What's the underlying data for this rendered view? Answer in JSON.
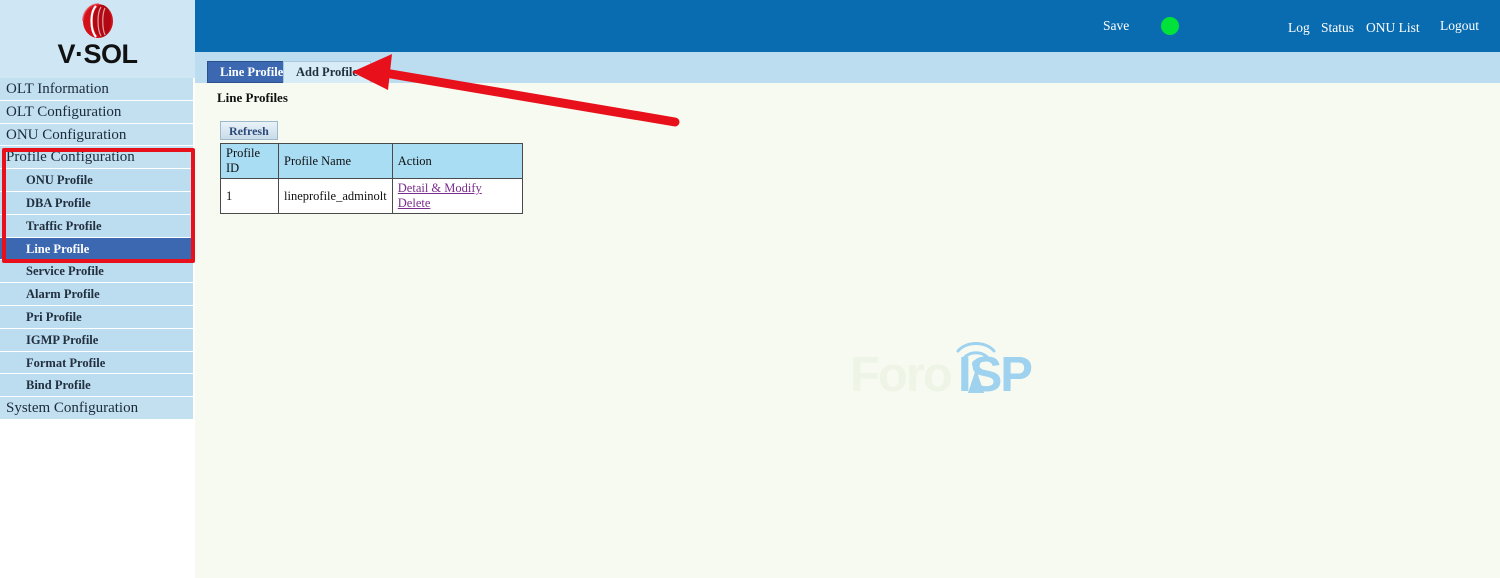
{
  "brand": {
    "logo_text": "V·SOL",
    "logo_icon": "vsol-sphere-logo"
  },
  "header": {
    "save_label": "Save",
    "status_dot": "status-indicator-green",
    "status_dot_color": "#00e23a",
    "log_label": "Log",
    "status_label": "Status",
    "onu_list_label": "ONU List",
    "logout_label": "Logout",
    "background_color": "#0a6cb0"
  },
  "sidebar": {
    "items": [
      {
        "label": "OLT Information",
        "level": "top",
        "selected": false
      },
      {
        "label": "OLT Configuration",
        "level": "top",
        "selected": false
      },
      {
        "label": "ONU Configuration",
        "level": "top",
        "selected": false
      },
      {
        "label": "Profile Configuration",
        "level": "top",
        "selected": false
      },
      {
        "label": "ONU Profile",
        "level": "sub",
        "selected": false
      },
      {
        "label": "DBA Profile",
        "level": "sub",
        "selected": false
      },
      {
        "label": "Traffic Profile",
        "level": "sub",
        "selected": false
      },
      {
        "label": "Line Profile",
        "level": "sub",
        "selected": true
      },
      {
        "label": "Service Profile",
        "level": "sub",
        "selected": false
      },
      {
        "label": "Alarm Profile",
        "level": "sub",
        "selected": false
      },
      {
        "label": "Pri Profile",
        "level": "sub",
        "selected": false
      },
      {
        "label": "IGMP Profile",
        "level": "sub",
        "selected": false
      },
      {
        "label": "Format Profile",
        "level": "sub",
        "selected": false
      },
      {
        "label": "Bind Profile",
        "level": "sub",
        "selected": false
      },
      {
        "label": "System Configuration",
        "level": "top",
        "selected": false
      }
    ],
    "selected_color": "#3b68b0",
    "item_color": "#c3e0f1"
  },
  "tabs": [
    {
      "label": "Line Profile",
      "active": true
    },
    {
      "label": "Add Profile",
      "active": false
    }
  ],
  "main": {
    "page_title": "Line Profiles",
    "refresh_label": "Refresh",
    "table": {
      "columns": [
        "Profile ID",
        "Profile Name",
        "Action"
      ],
      "rows": [
        {
          "profile_id": "1",
          "profile_name": "lineprofile_adminolt",
          "actions": [
            "Detail & Modify",
            "Delete"
          ]
        }
      ]
    }
  },
  "watermark": {
    "text_first": "Foro",
    "text_second": "ISP",
    "icon": "wifi-signal-icon",
    "color_first": "#eef4e6",
    "color_second": "#9ed2ef"
  },
  "annotations": {
    "highlight_box_color": "#e8111b",
    "arrow_color": "#e8111b",
    "arrow_points_to": "Add Profile"
  }
}
